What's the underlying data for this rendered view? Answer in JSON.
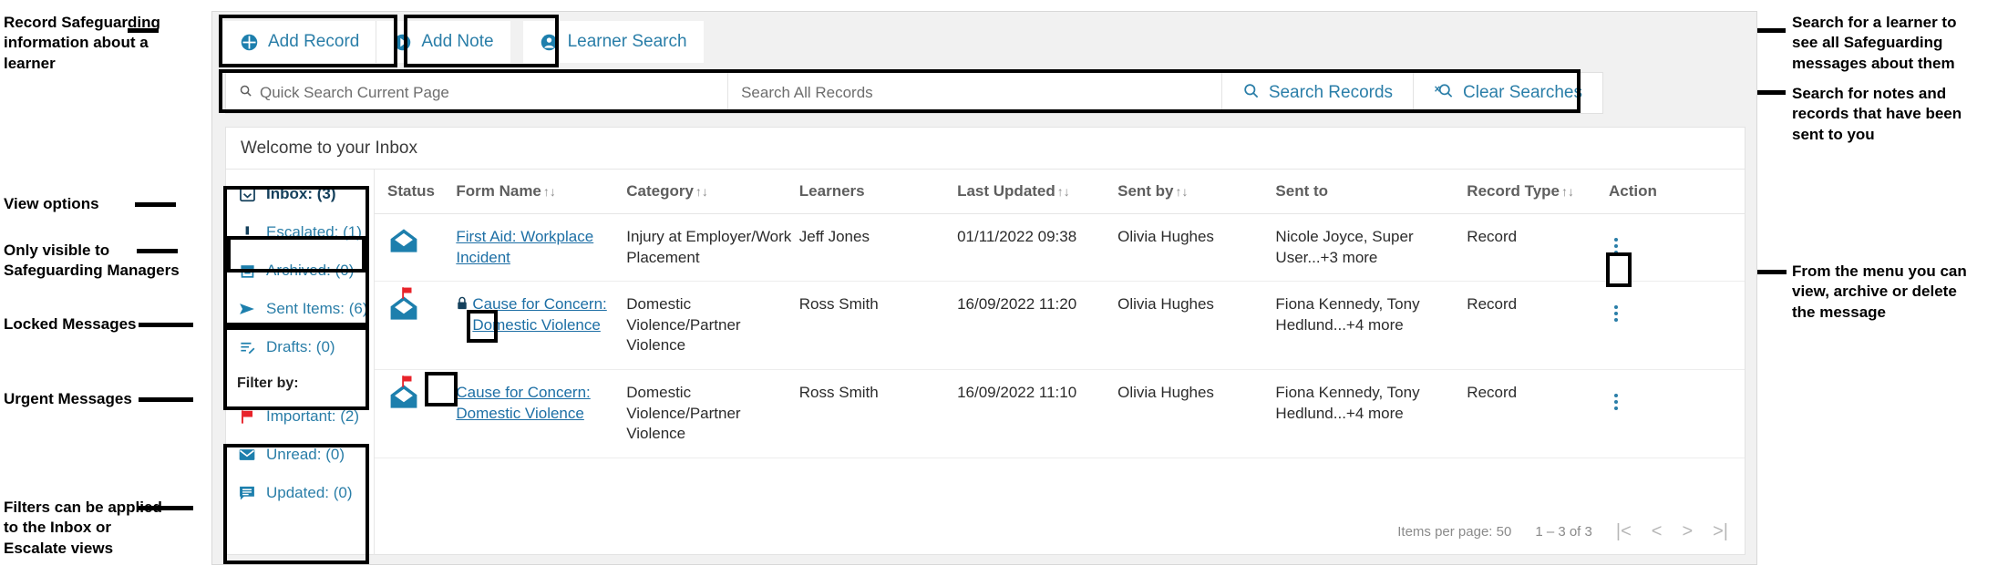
{
  "annotations": {
    "left": [
      {
        "id": "record-info",
        "text": "Record Safeguarding\ninformation about a\nlearner"
      },
      {
        "id": "view-options",
        "text": "View options"
      },
      {
        "id": "safeguarding-managers",
        "text": "Only visible to\nSafeguarding Managers"
      },
      {
        "id": "locked-messages",
        "text": "Locked Messages"
      },
      {
        "id": "urgent-messages",
        "text": "Urgent Messages"
      },
      {
        "id": "filters",
        "text": "Filters can be applied\nto the Inbox or\nEscalate views"
      }
    ],
    "right": [
      {
        "id": "learner-search",
        "text": "Search for a learner to\nsee all Safeguarding\nmessages about them"
      },
      {
        "id": "search-records",
        "text": "Search for notes and\nrecords that have been\nsent to you"
      },
      {
        "id": "action-menu",
        "text": "From the menu you can\nview, archive or delete\nthe message"
      }
    ]
  },
  "toolbar": {
    "add_record": "Add Record",
    "add_note": "Add Note",
    "learner_search": "Learner Search"
  },
  "search": {
    "quick_placeholder": "Quick Search Current Page",
    "all_placeholder": "Search All Records",
    "search_records_label": "Search Records",
    "clear_searches_label": "Clear Searches"
  },
  "card": {
    "welcome": "Welcome to your Inbox"
  },
  "sidebar": {
    "views": [
      {
        "icon": "inbox-icon",
        "label": "Inbox: (3)",
        "active": true
      },
      {
        "icon": "escalated-icon",
        "label": "Escalated: (1)",
        "active": false
      },
      {
        "icon": "archive-icon",
        "label": "Archived: (0)",
        "active": false
      },
      {
        "icon": "sent-icon",
        "label": "Sent Items: (6)",
        "active": false
      },
      {
        "icon": "drafts-icon",
        "label": "Drafts: (0)",
        "active": false
      }
    ],
    "filter_heading": "Filter by:",
    "filters": [
      {
        "icon": "flag-icon",
        "label": "Important: (2)"
      },
      {
        "icon": "unread-icon",
        "label": "Unread: (0)"
      },
      {
        "icon": "updated-icon",
        "label": "Updated: (0)"
      }
    ]
  },
  "table": {
    "columns": [
      {
        "label": "Status",
        "sortable": false
      },
      {
        "label": "Form Name",
        "sortable": true
      },
      {
        "label": "Category",
        "sortable": true
      },
      {
        "label": "Learners",
        "sortable": false
      },
      {
        "label": "Last Updated",
        "sortable": true
      },
      {
        "label": "Sent by",
        "sortable": true
      },
      {
        "label": "Sent to",
        "sortable": false
      },
      {
        "label": "Record Type",
        "sortable": true
      },
      {
        "label": "Action",
        "sortable": false
      }
    ],
    "rows": [
      {
        "status_icon": "envelope-open-icon",
        "flag": false,
        "locked": false,
        "form_name": "First Aid: Workplace Incident",
        "category": "Injury at Employer/Work Placement",
        "learners": "Jeff Jones",
        "last_updated": "01/11/2022 09:38",
        "sent_by": "Olivia Hughes",
        "sent_to": "Nicole Joyce, Super User...+3 more",
        "record_type": "Record"
      },
      {
        "status_icon": "envelope-open-icon",
        "flag": true,
        "locked": true,
        "form_name": "Cause for Concern: Domestic Violence",
        "category": "Domestic Violence/Partner Violence",
        "learners": "Ross Smith",
        "last_updated": "16/09/2022 11:20",
        "sent_by": "Olivia Hughes",
        "sent_to": "Fiona Kennedy, Tony Hedlund...+4 more",
        "record_type": "Record"
      },
      {
        "status_icon": "envelope-open-icon",
        "flag": true,
        "locked": false,
        "form_name": "Cause for Concern: Domestic Violence",
        "category": "Domestic Violence/Partner Violence",
        "learners": "Ross Smith",
        "last_updated": "16/09/2022 11:10",
        "sent_by": "Olivia Hughes",
        "sent_to": "Fiona Kennedy, Tony Hedlund...+4 more",
        "record_type": "Record"
      }
    ]
  },
  "paginator": {
    "items_per_page": "Items per page: 50",
    "range": "1 – 3 of 3",
    "first": "|<",
    "prev": "<",
    "next": ">",
    "last": ">|"
  },
  "colors": {
    "accent": "#2a7ea8",
    "link": "#1d6fa5",
    "flag_red": "#e8232a",
    "dark": "#14405c"
  }
}
